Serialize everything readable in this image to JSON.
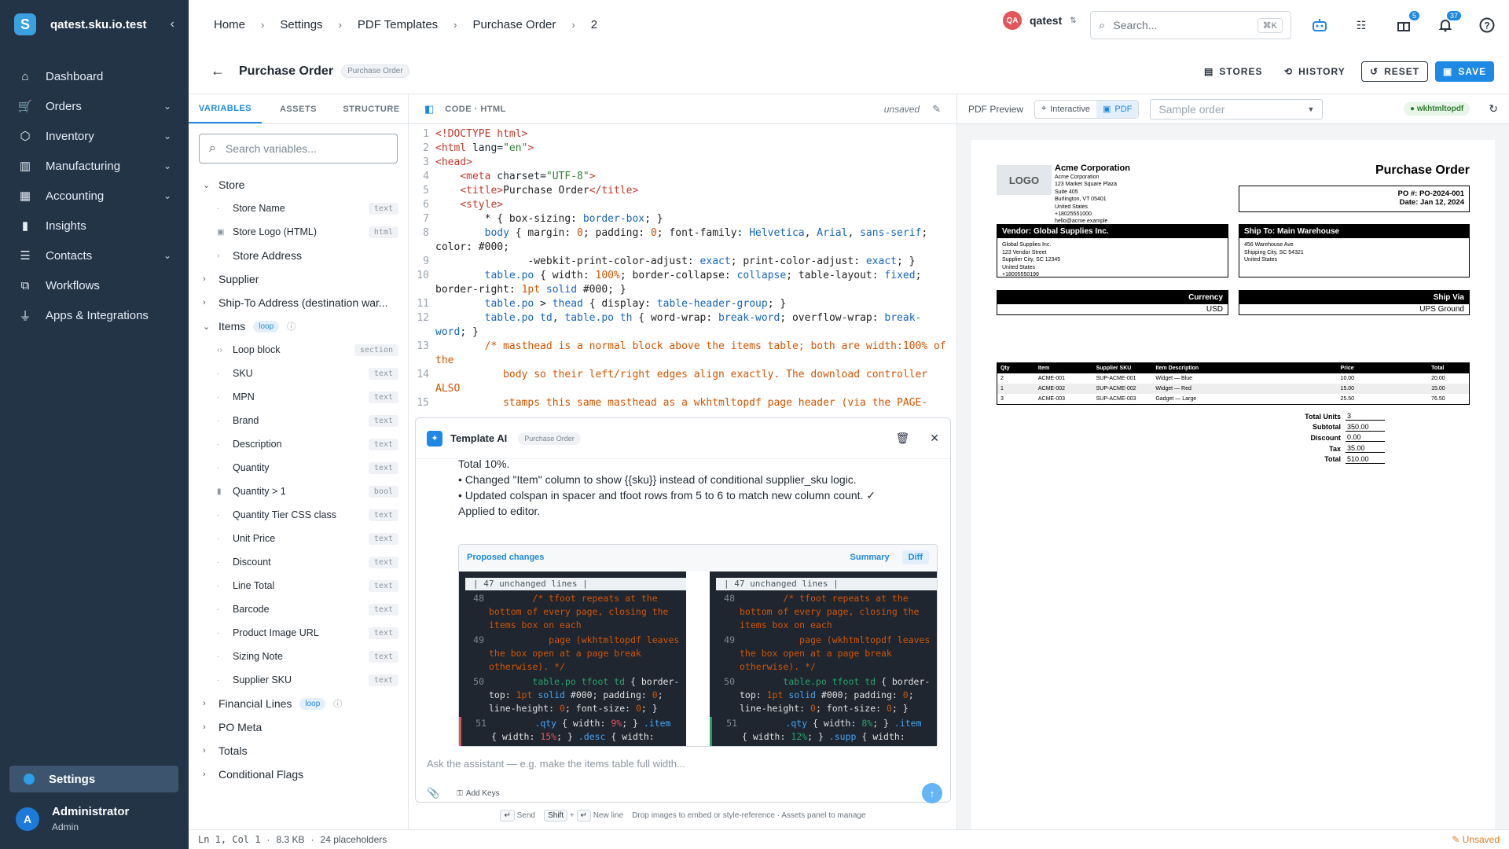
{
  "sidebar": {
    "brand": "qatest.sku.io.test",
    "brand_letter": "S",
    "items": [
      {
        "label": "Dashboard",
        "icon": "home-icon",
        "expandable": false
      },
      {
        "label": "Orders",
        "icon": "cart-icon",
        "expandable": true
      },
      {
        "label": "Inventory",
        "icon": "box-icon",
        "expandable": true
      },
      {
        "label": "Manufacturing",
        "icon": "factory-icon",
        "expandable": true
      },
      {
        "label": "Accounting",
        "icon": "calculator-icon",
        "expandable": true
      },
      {
        "label": "Insights",
        "icon": "bar-chart-icon",
        "expandable": false
      },
      {
        "label": "Contacts",
        "icon": "contacts-icon",
        "expandable": true
      },
      {
        "label": "Workflows",
        "icon": "workflow-icon",
        "expandable": false
      },
      {
        "label": "Apps & Integrations",
        "icon": "plug-icon",
        "expandable": false
      }
    ],
    "settings_label": "Settings",
    "user": {
      "initial": "A",
      "name": "Administrator",
      "role": "Admin"
    }
  },
  "breadcrumb": [
    "Home",
    "Settings",
    "PDF Templates",
    "Purchase Order",
    "2"
  ],
  "topbar": {
    "account_initials": "QA",
    "account_name": "qatest",
    "search_placeholder": "Search...",
    "search_shortcut": "⌘K",
    "gift_badge": "5",
    "notification_badge": "37"
  },
  "titlebar": {
    "title": "Purchase Order",
    "type_chip": "Purchase Order",
    "stores_label": "STORES",
    "history_label": "HISTORY",
    "reset_label": "RESET",
    "save_label": "SAVE"
  },
  "variables": {
    "tabs": [
      "VARIABLES",
      "ASSETS",
      "STRUCTURE"
    ],
    "search_placeholder": "Search variables...",
    "store": {
      "label": "Store",
      "children": [
        {
          "label": "Store Name",
          "tag": "text"
        },
        {
          "label": "Store Logo (HTML)",
          "tag": "html"
        }
      ],
      "address": "Store Address"
    },
    "supplier": "Supplier",
    "shipto": "Ship-To Address (destination war...",
    "items": {
      "label": "Items",
      "tag": "loop",
      "children": [
        {
          "label": "Loop block",
          "tag": "section"
        },
        {
          "label": "SKU",
          "tag": "text"
        },
        {
          "label": "MPN",
          "tag": "text"
        },
        {
          "label": "Brand",
          "tag": "text"
        },
        {
          "label": "Description",
          "tag": "text"
        },
        {
          "label": "Quantity",
          "tag": "text"
        },
        {
          "label": "Quantity > 1",
          "tag": "bool"
        },
        {
          "label": "Quantity Tier CSS class",
          "tag": "text"
        },
        {
          "label": "Unit Price",
          "tag": "text"
        },
        {
          "label": "Discount",
          "tag": "text"
        },
        {
          "label": "Line Total",
          "tag": "text"
        },
        {
          "label": "Barcode",
          "tag": "text"
        },
        {
          "label": "Product Image URL",
          "tag": "text"
        },
        {
          "label": "Sizing Note",
          "tag": "text"
        },
        {
          "label": "Supplier SKU",
          "tag": "text"
        }
      ]
    },
    "financial": {
      "label": "Financial Lines",
      "tag": "loop"
    },
    "po_meta": "PO Meta",
    "totals": "Totals",
    "flags": "Conditional Flags"
  },
  "code": {
    "header": "CODE · HTML",
    "state": "unsaved",
    "lines": [
      "1",
      "2",
      "3",
      "4",
      "5",
      "6",
      "7",
      "8",
      "",
      "9",
      "10",
      "",
      "11",
      "12",
      "",
      "13",
      "",
      "14",
      "",
      "15"
    ]
  },
  "ai": {
    "title": "Template AI",
    "chip": "Purchase Order",
    "msg_1": "Total 10%.",
    "msg_2": "• Changed \"Item\" column to show {{sku}} instead of conditional supplier_sku logic.",
    "msg_3": "• Updated colspan in spacer and tfoot rows from 5 to 6 to match new column count. ✓ Applied to editor.",
    "proposed_label": "Proposed changes",
    "summary_tab": "Summary",
    "diff_tab": "Diff",
    "unchanged": "| 47 unchanged lines |",
    "input_placeholder": "Ask the assistant — e.g. make the items table full width...",
    "add_keys": "Add Keys"
  },
  "hint": {
    "send_key": "↵",
    "send": "Send",
    "shift_key": "Shift",
    "plus": "+",
    "newline_key": "↵",
    "newline": "New line",
    "rest": "Drop images to embed or style-reference · Assets panel to manage"
  },
  "preview": {
    "label": "PDF Preview",
    "interactive": "Interactive",
    "pdf": "PDF",
    "sample_placeholder": "Sample order",
    "engine": "wkhtmltopdf",
    "doc": {
      "logo": "LOGO",
      "company": "Acme Corporation",
      "company_lines": [
        "Acme Corporation",
        "123 Market Square Plaza",
        "Suite 405",
        "Burlington, VT 05401",
        "United States",
        "+18025551000",
        "hello@acme.example"
      ],
      "title": "Purchase Order",
      "po_number": "PO #: PO-2024-001",
      "po_date": "Date: Jan 12, 2024",
      "vendor_head": "Vendor: Global Supplies Inc.",
      "vendor_lines": [
        "Global Supplies Inc.",
        "123 Vendor Street",
        "Supplier City, SC 12345",
        "United States",
        "+18005550199"
      ],
      "ship_head": "Ship To: Main Warehouse",
      "ship_lines": [
        "456 Warehouse Ave",
        "Shipping City, SC 54321",
        "United States"
      ],
      "currency_head": "Currency",
      "currency": "USD",
      "shipvia_head": "Ship Via",
      "shipvia": "UPS Ground",
      "table_head": [
        "Qty",
        "Item",
        "Supplier SKU",
        "Item Description",
        "Price",
        "Total"
      ],
      "rows": [
        [
          "2",
          "ACME-001",
          "SUP-ACME-001",
          "Widget — Blue",
          "10.00",
          "20.00"
        ],
        [
          "1",
          "ACME-002",
          "SUP-ACME-002",
          "Widget — Red",
          "15.00",
          "15.00"
        ],
        [
          "3",
          "ACME-003",
          "SUP-ACME-003",
          "Gadget — Large",
          "25.50",
          "76.50"
        ]
      ],
      "totals": [
        {
          "k": "Total Units",
          "v": "3"
        },
        {
          "k": "Subtotal",
          "v": "350.00"
        },
        {
          "k": "Discount",
          "v": "0.00"
        },
        {
          "k": "Tax",
          "v": "35.00"
        },
        {
          "k": "Total",
          "v": "510.00"
        }
      ]
    }
  },
  "status": {
    "position": "Ln 1, Col 1",
    "size": "8.3 KB",
    "placeholders": "24 placeholders",
    "dirty": "Unsaved"
  }
}
